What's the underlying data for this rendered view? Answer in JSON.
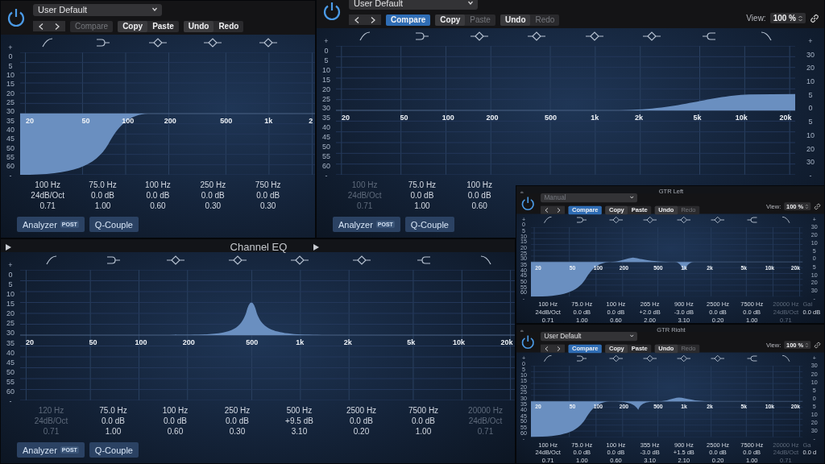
{
  "windows": [
    {
      "preset": {
        "value": "User Default",
        "enabled": true
      },
      "compare": {
        "label": "Compare",
        "on": false,
        "enabled": false
      },
      "clipboard": [
        {
          "label": "Copy",
          "enabled": true
        },
        {
          "label": "Paste",
          "enabled": true
        }
      ],
      "history": [
        {
          "label": "Undo",
          "enabled": true
        },
        {
          "label": "Redo",
          "enabled": true
        }
      ],
      "left_axis": [
        "+",
        "0",
        "5",
        "10",
        "15",
        "20",
        "25",
        "30",
        "35",
        "40",
        "45",
        "50",
        "55",
        "60",
        "-"
      ],
      "freq_labels": [
        "20",
        "50",
        "100",
        "200",
        "500",
        "1k",
        "2"
      ],
      "bands": [
        {
          "freq": "100 Hz",
          "gain": "24dB/Oct",
          "q": "0.71",
          "enabled": true
        },
        {
          "freq": "75.0 Hz",
          "gain": "0.0 dB",
          "q": "1.00",
          "enabled": true
        },
        {
          "freq": "100 Hz",
          "gain": "0.0 dB",
          "q": "0.60",
          "enabled": true
        },
        {
          "freq": "250 Hz",
          "gain": "0.0 dB",
          "q": "0.30",
          "enabled": true
        },
        {
          "freq": "750 Hz",
          "gain": "0.0 dB",
          "q": "0.30",
          "enabled": true
        }
      ],
      "footer": {
        "analyzer": {
          "label": "Analyzer",
          "badge": "POST"
        },
        "q_couple": "Q-Couple"
      }
    },
    {
      "preset": {
        "value": "User Default",
        "enabled": true
      },
      "compare": {
        "label": "Compare",
        "on": true,
        "enabled": true
      },
      "clipboard": [
        {
          "label": "Copy",
          "enabled": true
        },
        {
          "label": "Paste",
          "enabled": false
        }
      ],
      "history": [
        {
          "label": "Undo",
          "enabled": true
        },
        {
          "label": "Redo",
          "enabled": false
        }
      ],
      "view": {
        "label": "View:",
        "value": "100 %"
      },
      "left_axis": [
        "+",
        "0",
        "5",
        "10",
        "15",
        "20",
        "25",
        "30",
        "35",
        "40",
        "45",
        "50",
        "55",
        "60",
        "-"
      ],
      "right_axis": [
        "+",
        "30",
        "20",
        "10",
        "5",
        "0",
        "5",
        "10",
        "20",
        "30",
        "-"
      ],
      "freq_labels": [
        "20",
        "50",
        "100",
        "200",
        "500",
        "1k",
        "2k",
        "5k",
        "10k",
        "20k"
      ],
      "bands": [
        {
          "freq": "100 Hz",
          "gain": "24dB/Oct",
          "q": "0.71",
          "enabled": false
        },
        {
          "freq": "75.0 Hz",
          "gain": "0.0 dB",
          "q": "1.00",
          "enabled": true
        },
        {
          "freq": "100 Hz",
          "gain": "0.0 dB",
          "q": "0.60",
          "enabled": true
        }
      ],
      "footer": {
        "analyzer": {
          "label": "Analyzer",
          "badge": "POST"
        },
        "q_couple": "Q-Couple"
      }
    },
    {
      "title": "Channel EQ",
      "left_axis": [
        "+",
        "0",
        "5",
        "10",
        "15",
        "20",
        "25",
        "30",
        "35",
        "40",
        "45",
        "50",
        "55",
        "60",
        "-"
      ],
      "freq_labels": [
        "20",
        "50",
        "100",
        "200",
        "500",
        "1k",
        "2k",
        "5k",
        "10k",
        "20k"
      ],
      "bands": [
        {
          "freq": "120 Hz",
          "gain": "24dB/Oct",
          "q": "0.71",
          "enabled": false
        },
        {
          "freq": "75.0 Hz",
          "gain": "0.0 dB",
          "q": "1.00",
          "enabled": true
        },
        {
          "freq": "100 Hz",
          "gain": "0.0 dB",
          "q": "0.60",
          "enabled": true
        },
        {
          "freq": "250 Hz",
          "gain": "0.0 dB",
          "q": "0.30",
          "enabled": true
        },
        {
          "freq": "500 Hz",
          "gain": "+9.5 dB",
          "q": "3.10",
          "enabled": true
        },
        {
          "freq": "2500 Hz",
          "gain": "0.0 dB",
          "q": "0.20",
          "enabled": true
        },
        {
          "freq": "7500 Hz",
          "gain": "0.0 dB",
          "q": "1.00",
          "enabled": true
        },
        {
          "freq": "20000 Hz",
          "gain": "24dB/Oct",
          "q": "0.71",
          "enabled": false
        }
      ],
      "footer": {
        "analyzer": {
          "label": "Analyzer",
          "badge": "POST"
        },
        "q_couple": "Q-Couple"
      }
    },
    {
      "title": "GTR Left",
      "preset": {
        "value": "Manual",
        "enabled": false
      },
      "compare": {
        "label": "Compare",
        "on": true,
        "enabled": true
      },
      "clipboard": [
        {
          "label": "Copy",
          "enabled": true
        },
        {
          "label": "Paste",
          "enabled": true
        }
      ],
      "history": [
        {
          "label": "Undo",
          "enabled": true
        },
        {
          "label": "Redo",
          "enabled": false
        }
      ],
      "view": {
        "label": "View:",
        "value": "100 %"
      },
      "left_axis": [
        "+",
        "0",
        "5",
        "10",
        "15",
        "20",
        "25",
        "30",
        "35",
        "40",
        "45",
        "50",
        "55",
        "60",
        "-"
      ],
      "right_axis": [
        "+",
        "30",
        "20",
        "10",
        "5",
        "0",
        "5",
        "10",
        "20",
        "30",
        "-"
      ],
      "freq_labels": [
        "20",
        "50",
        "100",
        "200",
        "500",
        "1k",
        "2k",
        "5k",
        "10k",
        "20k"
      ],
      "bands": [
        {
          "freq": "100 Hz",
          "gain": "24dB/Oct",
          "q": "0.71",
          "enabled": true
        },
        {
          "freq": "75.0 Hz",
          "gain": "0.0 dB",
          "q": "1.00",
          "enabled": true
        },
        {
          "freq": "100 Hz",
          "gain": "0.0 dB",
          "q": "0.60",
          "enabled": true
        },
        {
          "freq": "265 Hz",
          "gain": "+2.0 dB",
          "q": "2.00",
          "enabled": true
        },
        {
          "freq": "900 Hz",
          "gain": "-3.0 dB",
          "q": "3.10",
          "enabled": true
        },
        {
          "freq": "2500 Hz",
          "gain": "0.0 dB",
          "q": "0.20",
          "enabled": true
        },
        {
          "freq": "7500 Hz",
          "gain": "0.0 dB",
          "q": "1.00",
          "enabled": true
        },
        {
          "freq": "20000 Hz",
          "gain": "24dB/Oct",
          "q": "0.71",
          "enabled": false
        }
      ],
      "gain": {
        "label": "Gai",
        "value": "0.0 dB"
      }
    },
    {
      "title": "GTR Right",
      "preset": {
        "value": "User Default",
        "enabled": true
      },
      "compare": {
        "label": "Compare",
        "on": true,
        "enabled": true
      },
      "clipboard": [
        {
          "label": "Copy",
          "enabled": true
        },
        {
          "label": "Paste",
          "enabled": true
        }
      ],
      "history": [
        {
          "label": "Undo",
          "enabled": true
        },
        {
          "label": "Redo",
          "enabled": false
        }
      ],
      "view": {
        "label": "View:",
        "value": "100 %"
      },
      "left_axis": [
        "+",
        "0",
        "5",
        "10",
        "15",
        "20",
        "25",
        "30",
        "35",
        "40",
        "45",
        "50",
        "55",
        "60",
        "-"
      ],
      "right_axis": [
        "+",
        "30",
        "20",
        "10",
        "5",
        "0",
        "5",
        "10",
        "20",
        "30",
        "-"
      ],
      "freq_labels": [
        "20",
        "50",
        "100",
        "200",
        "500",
        "1k",
        "2k",
        "5k",
        "10k",
        "20k"
      ],
      "bands": [
        {
          "freq": "100 Hz",
          "gain": "24dB/Oct",
          "q": "0.71",
          "enabled": true
        },
        {
          "freq": "75.0 Hz",
          "gain": "0.0 dB",
          "q": "1.00",
          "enabled": true
        },
        {
          "freq": "100 Hz",
          "gain": "0.0 dB",
          "q": "0.60",
          "enabled": true
        },
        {
          "freq": "355 Hz",
          "gain": "-3.0 dB",
          "q": "3.10",
          "enabled": true
        },
        {
          "freq": "900 Hz",
          "gain": "+1.5 dB",
          "q": "2.10",
          "enabled": true
        },
        {
          "freq": "2500 Hz",
          "gain": "0.0 dB",
          "q": "0.20",
          "enabled": true
        },
        {
          "freq": "7500 Hz",
          "gain": "0.0 dB",
          "q": "1.00",
          "enabled": true
        },
        {
          "freq": "20000 Hz",
          "gain": "24dB/Oct",
          "q": "0.71",
          "enabled": false
        }
      ],
      "gain": {
        "label": "Ga",
        "value": "0.0 d"
      }
    }
  ]
}
